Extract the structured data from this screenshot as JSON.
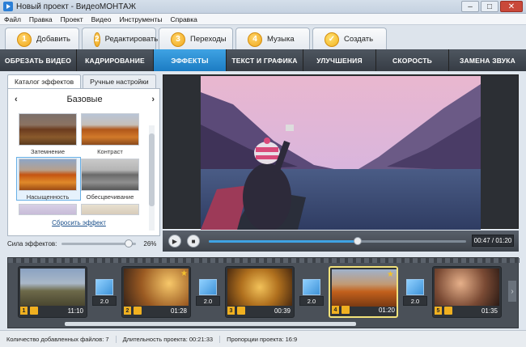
{
  "window": {
    "title": "Новый проект - ВидеоМОНТАЖ"
  },
  "menu": [
    "Файл",
    "Правка",
    "Проект",
    "Видео",
    "Инструменты",
    "Справка"
  ],
  "steps": [
    {
      "num": "1",
      "label": "Добавить"
    },
    {
      "num": "2",
      "label": "Редактировать"
    },
    {
      "num": "3",
      "label": "Переходы"
    },
    {
      "num": "4",
      "label": "Музыка"
    },
    {
      "num": "✓",
      "label": "Создать"
    }
  ],
  "subtabs": [
    "ОБРЕЗАТЬ ВИДЕО",
    "КАДРИРОВАНИЕ",
    "ЭФФЕКТЫ",
    "ТЕКСТ И ГРАФИКА",
    "УЛУЧШЕНИЯ",
    "СКОРОСТЬ",
    "ЗАМЕНА ЗВУКА"
  ],
  "effects": {
    "tabs": [
      "Каталог эффектов",
      "Ручные настройки"
    ],
    "category": "Базовые",
    "items": [
      "Затемнение",
      "Контраст",
      "Насыщенность",
      "Обесцвечивание"
    ],
    "reset": "Сбросить эффект",
    "strength_label": "Сила эффектов:",
    "strength_value": "26%",
    "strength_fraction": 0.9
  },
  "player": {
    "time": "00:47 / 01:20",
    "progress": 0.58
  },
  "timeline": {
    "clips": [
      {
        "num": "1",
        "duration": "11:10"
      },
      {
        "num": "2",
        "duration": "01:28"
      },
      {
        "num": "3",
        "duration": "00:39"
      },
      {
        "num": "4",
        "duration": "01:20"
      },
      {
        "num": "5",
        "duration": "01:35"
      }
    ],
    "transitions": [
      "2.0",
      "2.0",
      "2.0",
      "2.0"
    ]
  },
  "status": {
    "files": "Количество добавленных файлов: 7",
    "duration": "Длительность проекта: 00:21:33",
    "ratio": "Пропорции проекта: 16:9"
  }
}
